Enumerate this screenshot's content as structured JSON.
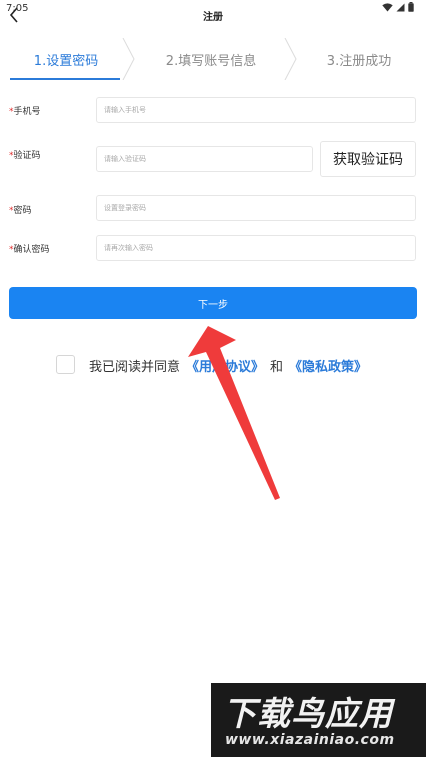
{
  "status_bar": {
    "time": "7:05",
    "icons": [
      "wifi-icon",
      "signal-icon",
      "battery-icon"
    ]
  },
  "header": {
    "title": "注册",
    "back_icon": "back-chevron-icon"
  },
  "steps": [
    {
      "label": "1.设置密码",
      "active": true
    },
    {
      "label": "2.填写账号信息",
      "active": false
    },
    {
      "label": "3.注册成功",
      "active": false
    }
  ],
  "form": {
    "phone": {
      "label": "手机号",
      "required": "*",
      "placeholder": "请输入手机号",
      "value": ""
    },
    "code": {
      "label": "验证码",
      "required": "*",
      "placeholder": "请输入验证码",
      "value": ""
    },
    "get_code_label": "获取验证码",
    "password": {
      "label": "密码",
      "required": "*",
      "placeholder": "设置登录密码",
      "value": ""
    },
    "confirm": {
      "label": "确认密码",
      "required": "*",
      "placeholder": "请再次输入密码",
      "value": ""
    }
  },
  "next_button_label": "下一步",
  "agreement": {
    "checked": false,
    "prefix": "我已阅读并同意",
    "user_agreement": "《用户协议》",
    "conjunction": "和",
    "privacy_policy": "《隐私政策》"
  },
  "watermark": {
    "title": "下载鸟应用",
    "url": "www.xiazainiao.com"
  },
  "colors": {
    "accent": "#1a84f2",
    "link": "#2b7bd9",
    "required": "#e03030",
    "arrow": "#ef3b3b"
  }
}
